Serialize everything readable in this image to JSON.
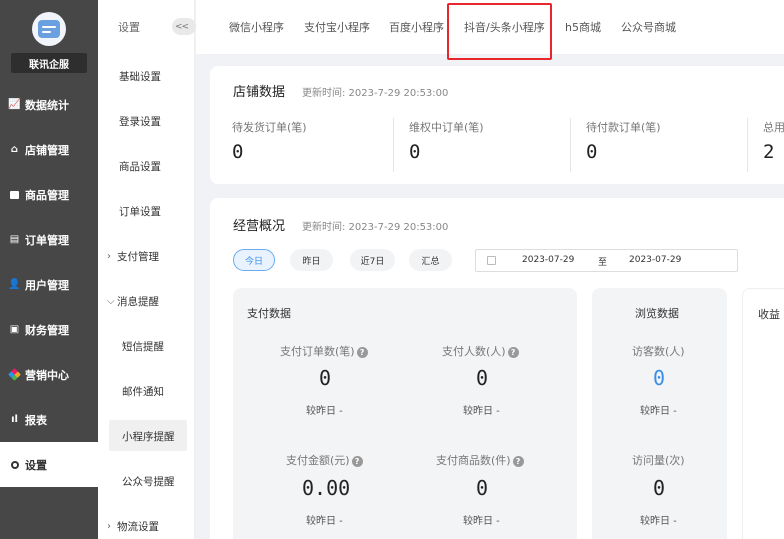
{
  "sidebar": {
    "company": "联讯企服",
    "items": [
      {
        "label": "数据统计",
        "icon": "line-chart-icon"
      },
      {
        "label": "店铺管理",
        "icon": "store-icon"
      },
      {
        "label": "商品管理",
        "icon": "goods-icon"
      },
      {
        "label": "订单管理",
        "icon": "order-icon"
      },
      {
        "label": "用户管理",
        "icon": "user-icon"
      },
      {
        "label": "财务管理",
        "icon": "finance-icon"
      },
      {
        "label": "营销中心",
        "icon": "marketing-icon"
      },
      {
        "label": "报表",
        "icon": "bar-chart-icon"
      },
      {
        "label": "设置",
        "icon": "settings-icon"
      }
    ]
  },
  "submenu": {
    "header": "设置",
    "collapse": "<<",
    "items": [
      "基础设置",
      "登录设置",
      "商品设置",
      "订单设置",
      "支付管理",
      "消息提醒",
      "短信提醒",
      "邮件通知",
      "小程序提醒",
      "公众号提醒",
      "物流设置"
    ]
  },
  "tabs": [
    "微信小程序",
    "支付宝小程序",
    "百度小程序",
    "抖音/头条小程序",
    "h5商城",
    "公众号商城"
  ],
  "store": {
    "title": "店铺数据",
    "updated": "更新时间: 2023-7-29 20:53:00",
    "stats": [
      {
        "label": "待发货订单(笔)",
        "value": "0"
      },
      {
        "label": "维权中订单(笔)",
        "value": "0"
      },
      {
        "label": "待付款订单(笔)",
        "value": "0"
      },
      {
        "label": "总用",
        "value": "2"
      }
    ]
  },
  "overview": {
    "title": "经营概况",
    "updated": "更新时间: 2023-7-29 20:53:00",
    "ranges": [
      "今日",
      "昨日",
      "近7日",
      "汇总"
    ],
    "date_from": "2023-07-29",
    "date_sep": "至",
    "date_to": "2023-07-29",
    "pay": {
      "title": "支付数据",
      "metrics": [
        {
          "label": "支付订单数(笔)",
          "value": "0",
          "compare": "较昨日 -"
        },
        {
          "label": "支付人数(人)",
          "value": "0",
          "compare": "较昨日 -"
        },
        {
          "label": "支付金额(元)",
          "value": "0.00",
          "compare": "较昨日 -"
        },
        {
          "label": "支付商品数(件)",
          "value": "0",
          "compare": "较昨日 -"
        }
      ]
    },
    "browse": {
      "title": "浏览数据",
      "metrics": [
        {
          "label": "访客数(人)",
          "value": "0",
          "compare": "较昨日 -"
        },
        {
          "label": "访问量(次)",
          "value": "0",
          "compare": "较昨日 -"
        }
      ]
    },
    "revenue": {
      "title": "收益"
    }
  },
  "colors": {
    "accent": "#3a8ee6",
    "sidebar": "#474747",
    "highlight": "#e8262b"
  }
}
